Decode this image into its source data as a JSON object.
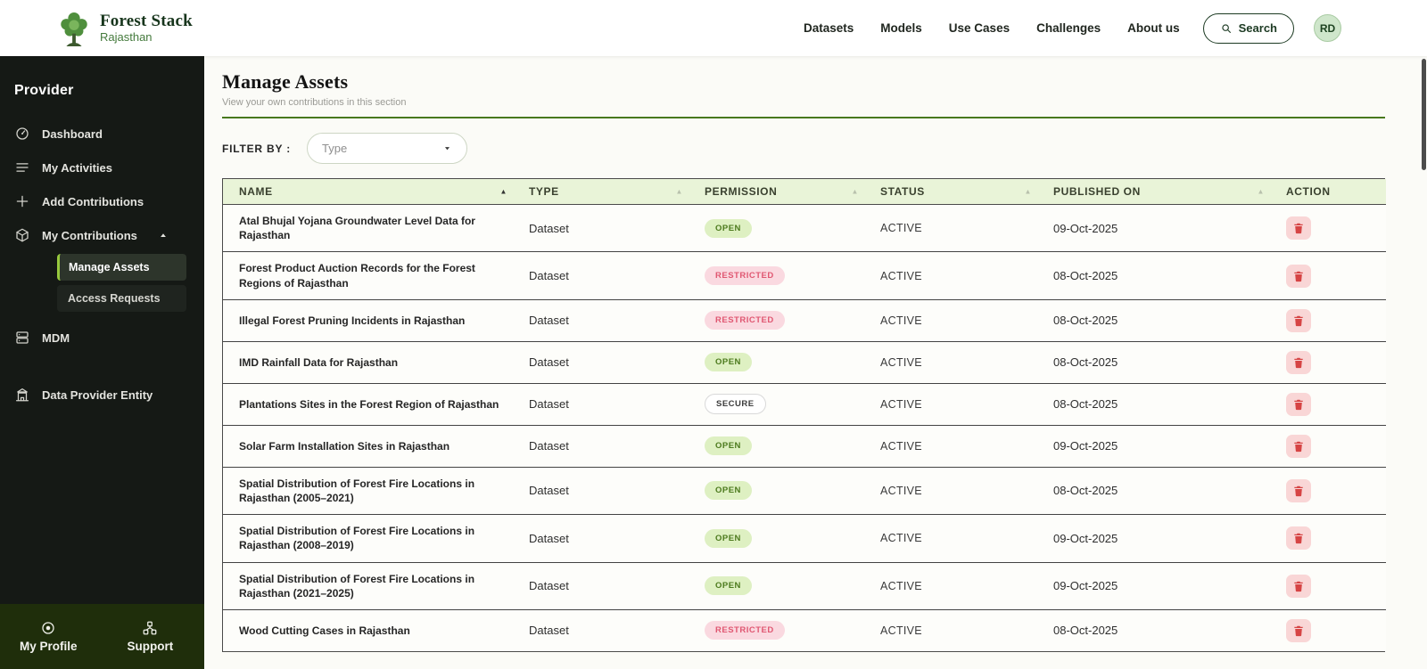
{
  "colors": {
    "accent_green": "#97c93d",
    "brand_green": "#1d3a22",
    "header_link": "#20261f",
    "open_bg": "#def0c2",
    "open_text": "#4c7a1d",
    "restricted_bg": "#fad9e0",
    "restricted_text": "#e05872",
    "secure_bg": "#ffffff",
    "secure_text": "#3c3c3c",
    "delete_red": "#d64444",
    "delete_bg": "#f9d6d6",
    "table_header_bg": "#e9f4d8",
    "divider_green": "#47781e",
    "sidebar_bg": "#151915",
    "sidebar_footer_bg": "#1f2e0b"
  },
  "brand": {
    "title": "Forest Stack",
    "subtitle": "Rajasthan"
  },
  "header": {
    "nav": [
      "Datasets",
      "Models",
      "Use Cases",
      "Challenges",
      "About us"
    ],
    "search_label": "Search",
    "avatar_initials": "RD"
  },
  "sidebar": {
    "section_title": "Provider",
    "items": [
      {
        "label": "Dashboard",
        "icon": "dashboard"
      },
      {
        "label": "My Activities",
        "icon": "activities"
      },
      {
        "label": "Add Contributions",
        "icon": "plus"
      },
      {
        "label": "My Contributions",
        "icon": "contributions",
        "expanded": true,
        "children": [
          {
            "label": "Manage Assets",
            "active": true
          },
          {
            "label": "Access Requests",
            "active": false
          }
        ]
      },
      {
        "label": "MDM",
        "icon": "mdm"
      },
      {
        "label": "Data Provider Entity",
        "icon": "entity",
        "gap": true
      }
    ],
    "footer": [
      {
        "label": "My Profile",
        "icon": "profile"
      },
      {
        "label": "Support",
        "icon": "support"
      }
    ]
  },
  "main": {
    "title": "Manage Assets",
    "subtitle": "View your own contributions in this section",
    "filter_label": "FILTER BY :",
    "filter_value": "Type",
    "table": {
      "columns": [
        {
          "label": "NAME",
          "sortable": true,
          "sorted": true
        },
        {
          "label": "TYPE",
          "sortable": true,
          "sorted": false
        },
        {
          "label": "PERMISSION",
          "sortable": true,
          "sorted": false
        },
        {
          "label": "STATUS",
          "sortable": true,
          "sorted": false
        },
        {
          "label": "PUBLISHED ON",
          "sortable": true,
          "sorted": false
        },
        {
          "label": "ACTION",
          "sortable": false,
          "sorted": false
        }
      ],
      "rows": [
        {
          "name": "Atal Bhujal Yojana Groundwater Level Data for Rajasthan",
          "type": "Dataset",
          "permission": "OPEN",
          "status": "ACTIVE",
          "published": "09-Oct-2025"
        },
        {
          "name": "Forest Product Auction Records for the Forest Regions of Rajasthan",
          "type": "Dataset",
          "permission": "RESTRICTED",
          "status": "ACTIVE",
          "published": "08-Oct-2025"
        },
        {
          "name": "Illegal Forest Pruning Incidents in Rajasthan",
          "type": "Dataset",
          "permission": "RESTRICTED",
          "status": "ACTIVE",
          "published": "08-Oct-2025"
        },
        {
          "name": "IMD Rainfall Data for Rajasthan",
          "type": "Dataset",
          "permission": "OPEN",
          "status": "ACTIVE",
          "published": "08-Oct-2025"
        },
        {
          "name": "Plantations Sites in the Forest Region of Rajasthan",
          "type": "Dataset",
          "permission": "SECURE",
          "status": "ACTIVE",
          "published": "08-Oct-2025"
        },
        {
          "name": "Solar Farm Installation Sites in Rajasthan",
          "type": "Dataset",
          "permission": "OPEN",
          "status": "ACTIVE",
          "published": "09-Oct-2025"
        },
        {
          "name": "Spatial Distribution of Forest Fire Locations in Rajasthan (2005–2021)",
          "type": "Dataset",
          "permission": "OPEN",
          "status": "ACTIVE",
          "published": "08-Oct-2025"
        },
        {
          "name": "Spatial Distribution of Forest Fire Locations in Rajasthan (2008–2019)",
          "type": "Dataset",
          "permission": "OPEN",
          "status": "ACTIVE",
          "published": "09-Oct-2025"
        },
        {
          "name": "Spatial Distribution of Forest Fire Locations in Rajasthan (2021–2025)",
          "type": "Dataset",
          "permission": "OPEN",
          "status": "ACTIVE",
          "published": "09-Oct-2025"
        },
        {
          "name": "Wood Cutting Cases in Rajasthan",
          "type": "Dataset",
          "permission": "RESTRICTED",
          "status": "ACTIVE",
          "published": "08-Oct-2025"
        }
      ]
    }
  }
}
